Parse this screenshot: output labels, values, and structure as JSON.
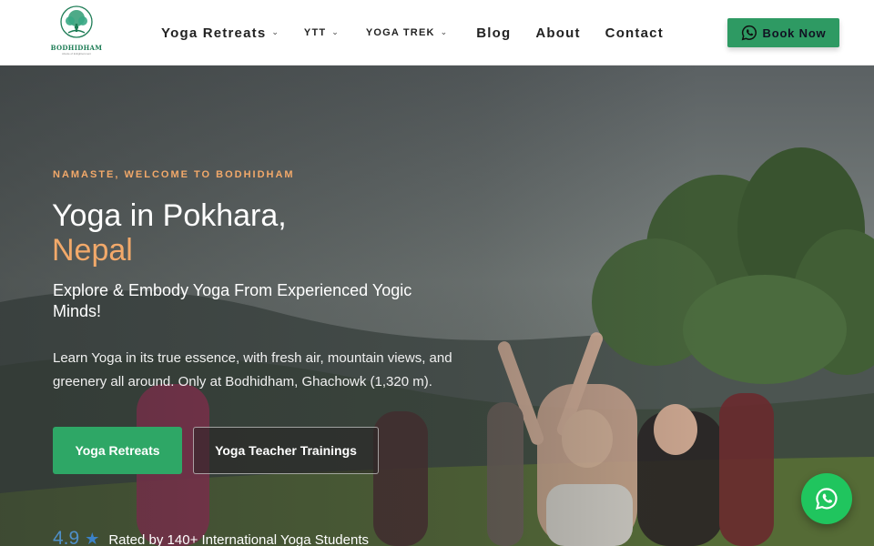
{
  "brand": {
    "name": "BODHIDHAM",
    "tagline": "Abode of Enlightenment"
  },
  "nav": {
    "items": [
      {
        "label": "Yoga Retreats",
        "has_dropdown": true
      },
      {
        "label": "YTT",
        "has_dropdown": true
      },
      {
        "label": "YOGA TREK",
        "has_dropdown": true
      },
      {
        "label": "Blog",
        "has_dropdown": false
      },
      {
        "label": "About",
        "has_dropdown": false
      },
      {
        "label": "Contact",
        "has_dropdown": false
      }
    ],
    "chevron": "⌄",
    "book_label": "Book Now"
  },
  "hero": {
    "eyebrow": "NAMASTE, WELCOME TO BODHIDHAM",
    "title": "Yoga in Pokhara,",
    "title_accent": "Nepal",
    "subtitle": "Explore & Embody Yoga From Experienced Yogic Minds!",
    "description": "Learn Yoga in its true essence, with fresh air, mountain views, and greenery all around. Only at Bodhidham, Ghachowk (1,320 m).",
    "primary_button": "Yoga Retreats",
    "secondary_button": "Yoga Teacher Trainings",
    "rating_score": "4.9",
    "rating_star": "★",
    "rating_text": "Rated by 140+ International Yoga Students"
  },
  "icons": {
    "whatsapp": "whatsapp-icon",
    "chevron": "chevron-down-icon",
    "star": "star-icon"
  },
  "colors": {
    "brand_green": "#2e9a63",
    "accent_orange": "#f2a96a",
    "whatsapp_green": "#20c55e",
    "rating_blue": "#4f8fc8"
  }
}
